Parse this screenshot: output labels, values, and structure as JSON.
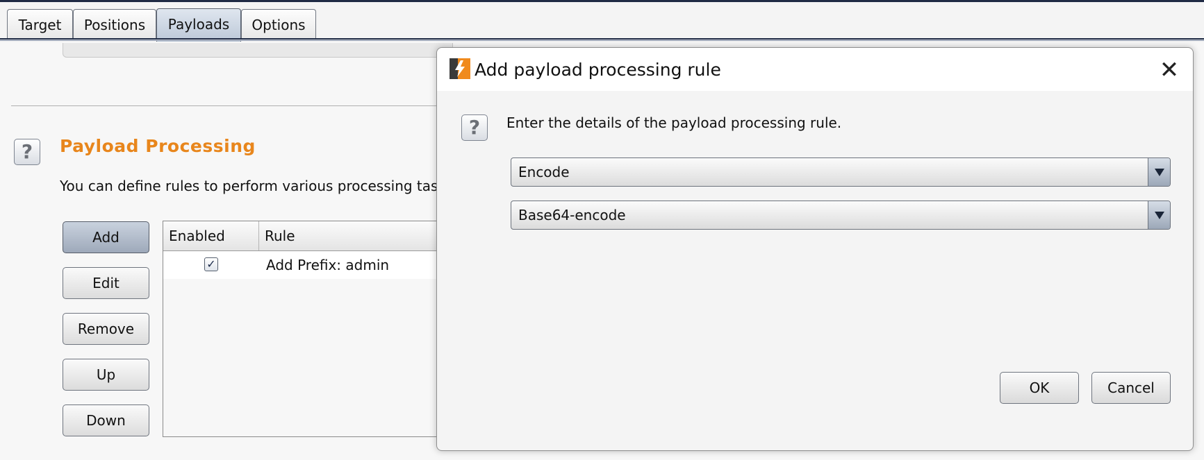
{
  "tabs": [
    {
      "label": "Target"
    },
    {
      "label": "Positions"
    },
    {
      "label": "Payloads",
      "active": true
    },
    {
      "label": "Options"
    }
  ],
  "section": {
    "title": "Payload Processing",
    "description": "You can define rules to perform various processing task",
    "buttons": {
      "add": "Add",
      "edit": "Edit",
      "remove": "Remove",
      "up": "Up",
      "down": "Down"
    },
    "table": {
      "columns": [
        "Enabled",
        "Rule"
      ],
      "rows": [
        {
          "enabled": true,
          "rule": "Add Prefix: admin"
        }
      ]
    }
  },
  "dialog": {
    "title": "Add payload processing rule",
    "message": "Enter the details of the payload processing rule.",
    "rule_type": "Encode",
    "encoding": "Base64-encode",
    "ok_label": "OK",
    "cancel_label": "Cancel",
    "close_glyph": "✕"
  },
  "icons": {
    "help": "question-mark-icon",
    "app": "burp-lightning-icon",
    "dropdown": "triangle-down-icon"
  },
  "colors": {
    "section_title": "#e8861c",
    "app_icon_bg": "#f08a1d",
    "active_tab": "#bcc8d8"
  },
  "help_glyph": "?",
  "check_glyph": "✓"
}
